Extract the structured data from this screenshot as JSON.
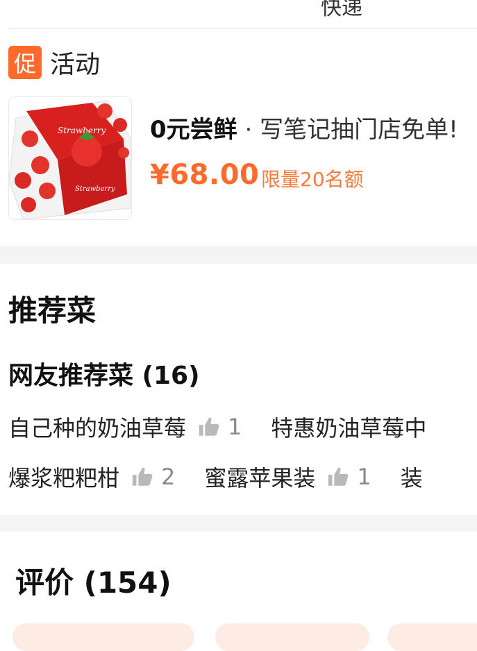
{
  "top": {
    "cut_text": "快递"
  },
  "promo": {
    "tag": "促",
    "title": "活动"
  },
  "deal": {
    "title_bold": "0元尝鲜",
    "title_rest": " · 写笔记抽门店免单!",
    "price": "¥68.00",
    "limit": "限量20名额"
  },
  "recommend": {
    "section_title": "推荐菜",
    "subtitle": "网友推荐菜 (16)",
    "row1": [
      {
        "name": "自己种的奶油草莓",
        "likes": "1"
      },
      {
        "name": "特惠奶油草莓中",
        "likes": ""
      }
    ],
    "row2": [
      {
        "name": "爆浆粑粑柑",
        "likes": "2"
      },
      {
        "name": "蜜露苹果装",
        "likes": "1"
      },
      {
        "name": "装",
        "likes": ""
      }
    ]
  },
  "reviews": {
    "title": "评价 (154)"
  },
  "colors": {
    "accent": "#ff6a2b",
    "divider": "#f4f4f4",
    "chip_bg": "#fdebe4"
  },
  "icons": {
    "promo": "promo-tag-icon",
    "like": "thumbs-up-icon",
    "product": "strawberry-box-image"
  }
}
